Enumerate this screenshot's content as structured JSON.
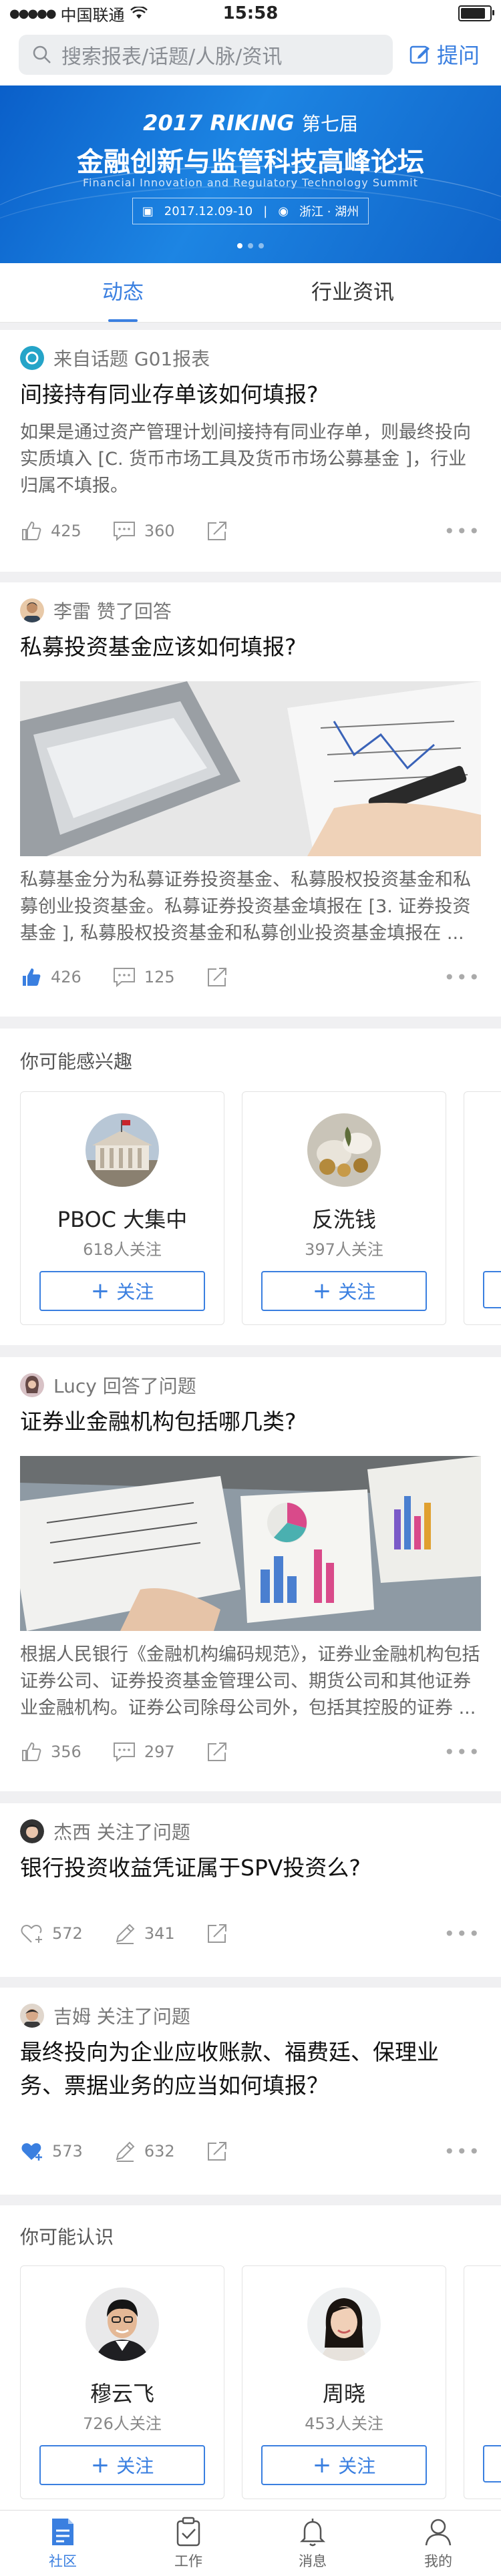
{
  "status_bar": {
    "carrier": "中国联通",
    "time": "15:58",
    "signal_dots": "●●●●●"
  },
  "header": {
    "search_placeholder": "搜索报表/话题/人脉/资讯",
    "ask_label": "提问"
  },
  "banner": {
    "line1_year": "2017",
    "line1_brand": "RIKING",
    "line1_suffix": "第七届",
    "title": "金融创新与监管科技高峰论坛",
    "subtitle_en": "Financial Innovation and Regulatory Technology Summit",
    "date": "2017.12.09-10",
    "place": "浙江 · 湖州"
  },
  "tabs": [
    {
      "label": "动态"
    },
    {
      "label": "行业资讯"
    }
  ],
  "feed": {
    "card1": {
      "context": "来自话题  G01报表",
      "question": "间接持有同业存单该如何填报?",
      "excerpt": "如果是通过资产管理计划间接持有同业存单，则最终投向实质填入 [C. 货币市场工具及货币市场公募基金 ]，行业归属不填报。",
      "likes": "425",
      "comments": "360"
    },
    "card2": {
      "context": "李雷  赞了回答",
      "question": "私募投资基金应该如何填报?",
      "excerpt": "私募基金分为私募证券投资基金、私募股权投资基金和私募创业投资基金。私募证券投资基金填报在 [3. 证券投资基金 ], 私募股权投资基金和私募创业投资基金填报在 ...",
      "likes": "426",
      "comments": "125"
    },
    "interest": {
      "title": "你可能感兴趣",
      "items": [
        {
          "name": "PBOC 大集中",
          "count": "618人关注",
          "follow": "关注"
        },
        {
          "name": "反洗钱",
          "count": "397人关注",
          "follow": "关注"
        }
      ]
    },
    "card3": {
      "context": "Lucy  回答了问题",
      "question": "证券业金融机构包括哪几类?",
      "excerpt": "根据人民银行《金融机构编码规范》，证券业金融机构包括证券公司、证券投资基金管理公司、期货公司和其他证券业金融机构。证券公司除母公司外，包括其控股的证券 ...",
      "likes": "356",
      "comments": "297"
    },
    "card4": {
      "context": "杰西  关注了问题",
      "question": "银行投资收益凭证属于SPV投资么?",
      "follows": "572",
      "answers": "341"
    },
    "card5": {
      "context": "吉姆  关注了问题",
      "question": "最终投向为企业应收账款、福费廷、保理业务、票据业务的应当如何填报？",
      "follows": "573",
      "answers": "632"
    },
    "people": {
      "title": "你可能认识",
      "items": [
        {
          "name": "穆云飞",
          "count": "726人关注",
          "follow": "关注"
        },
        {
          "name": "周晓",
          "count": "453人关注",
          "follow": "关注"
        }
      ]
    }
  },
  "tabbar": [
    {
      "label": "社区"
    },
    {
      "label": "工作"
    },
    {
      "label": "消息"
    },
    {
      "label": "我的"
    }
  ],
  "colors": {
    "accent": "#3a7fe0",
    "banner": "#1776dc"
  }
}
